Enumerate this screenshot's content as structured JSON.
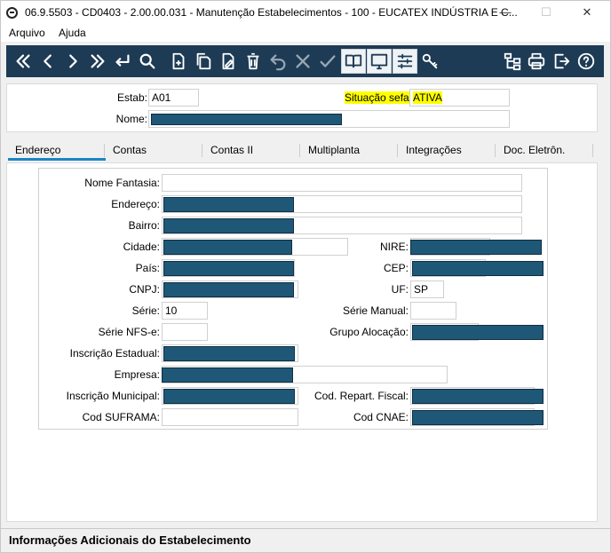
{
  "window": {
    "title": "06.9.5503 - CD0403 - 2.00.00.031 - Manutenção Estabelecimentos - 100 - EUCATEX INDÚSTRIA E C...",
    "minimize": "—",
    "maximize": "☐",
    "close": "✕"
  },
  "menu": [
    "Arquivo",
    "Ajuda"
  ],
  "toolbar": {
    "icons": [
      "first-record-icon",
      "prev-record-icon",
      "next-record-icon",
      "last-record-icon",
      "return-icon",
      "search-icon",
      "new-record-icon",
      "copy-record-icon",
      "edit-record-icon",
      "delete-icon",
      "undo-icon",
      "cancel-icon",
      "confirm-icon",
      "book-icon",
      "monitor-icon",
      "settings-sliders-icon",
      "key-icon",
      "tree-structure-icon",
      "print-icon",
      "exit-icon",
      "help-icon"
    ]
  },
  "header": {
    "estab_label": "Estab:",
    "estab_value": "A01",
    "situacao_label": "Situação sefaz:",
    "situacao_value": "ATIVA",
    "nome_label": "Nome:"
  },
  "tabs": [
    "Endereço",
    "Contas",
    "Contas II",
    "Multiplanta",
    "Integrações",
    "Doc. Eletrôn."
  ],
  "form": {
    "nome_fantasia": "Nome Fantasia:",
    "endereco": "Endereço:",
    "bairro": "Bairro:",
    "cidade": "Cidade:",
    "nire": "NIRE:",
    "pais": "País:",
    "cep": "CEP:",
    "cnpj": "CNPJ:",
    "uf": "UF:",
    "uf_value": "SP",
    "serie": "Série:",
    "serie_value": "10",
    "serie_manual": "Série Manual:",
    "serie_nfse": "Série NFS-e:",
    "grupo_alocacao": "Grupo Alocação:",
    "inscricao_estadual": "Inscrição Estadual:",
    "empresa": "Empresa:",
    "inscricao_municipal": "Inscrição Municipal:",
    "cod_repart_fiscal": "Cod. Repart. Fiscal:",
    "cod_suframa": "Cod SUFRAMA:",
    "cod_cnae": "Cod CNAE:"
  },
  "footer": {
    "title": "Informações Adicionais do Estabelecimento"
  },
  "colors": {
    "toolbar_bg": "#1d3b55",
    "masked_value": "#1f5777",
    "tab_accent": "#1a86c4",
    "highlight": "#ffff00"
  }
}
